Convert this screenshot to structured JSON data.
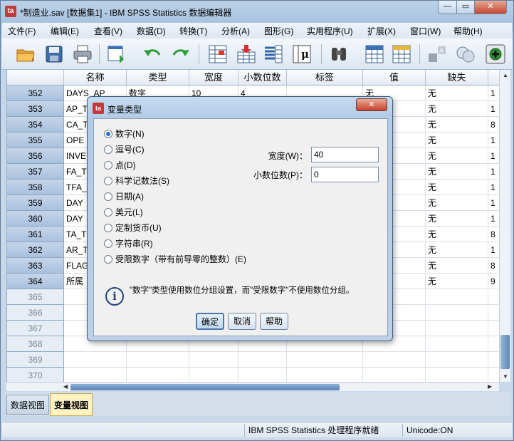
{
  "window": {
    "title": "*制造业.sav [数据集1] - IBM SPSS Statistics 数据编辑器",
    "app_icon": "spss-data-editor-icon"
  },
  "menu": [
    "文件(F)",
    "编辑(E)",
    "查看(V)",
    "数据(D)",
    "转换(T)",
    "分析(A)",
    "图形(G)",
    "实用程序(U)",
    "扩展(X)",
    "窗口(W)",
    "帮助(H)"
  ],
  "toolbar": [
    "open-folder-icon",
    "save-icon",
    "print-icon",
    "recall-dialog-icon",
    "undo-icon",
    "redo-icon",
    "goto-case-icon",
    "goto-variable-icon",
    "variables-icon",
    "value-labels-icon",
    "find-icon",
    "insert-cases-icon",
    "insert-variable-icon",
    "split-file-icon",
    "weight-cases-icon",
    "use-sets-icon",
    "add-icon"
  ],
  "grid": {
    "headers": [
      "名称",
      "类型",
      "宽度",
      "小数位数",
      "标签",
      "值",
      "缺失"
    ],
    "rows": [
      {
        "num": "352",
        "name": "DAYS_AP",
        "type": "数字",
        "width": "10",
        "dec": "4",
        "value": "无",
        "missing": "无",
        "extra": "1"
      },
      {
        "num": "353",
        "name": "AP_T",
        "type": "",
        "width": "",
        "dec": "",
        "value": "",
        "missing": "无",
        "extra": "1"
      },
      {
        "num": "354",
        "name": "CA_T",
        "type": "",
        "width": "",
        "dec": "",
        "value": "",
        "missing": "无",
        "extra": "8"
      },
      {
        "num": "355",
        "name": "OPE",
        "type": "",
        "width": "",
        "dec": "",
        "value": "",
        "missing": "无",
        "extra": "1"
      },
      {
        "num": "356",
        "name": "INVE",
        "type": "",
        "width": "",
        "dec": "",
        "value": "",
        "missing": "无",
        "extra": "1"
      },
      {
        "num": "357",
        "name": "FA_T",
        "type": "",
        "width": "",
        "dec": "",
        "value": "",
        "missing": "无",
        "extra": "1"
      },
      {
        "num": "358",
        "name": "TFA_",
        "type": "",
        "width": "",
        "dec": "",
        "value": "",
        "missing": "无",
        "extra": "1"
      },
      {
        "num": "359",
        "name": "DAY",
        "type": "",
        "width": "",
        "dec": "",
        "value": "",
        "missing": "无",
        "extra": "1"
      },
      {
        "num": "360",
        "name": "DAY",
        "type": "",
        "width": "",
        "dec": "",
        "value": "",
        "missing": "无",
        "extra": "1"
      },
      {
        "num": "361",
        "name": "TA_T",
        "type": "",
        "width": "",
        "dec": "",
        "value": "",
        "missing": "无",
        "extra": "8"
      },
      {
        "num": "362",
        "name": "AR_T",
        "type": "",
        "width": "",
        "dec": "",
        "value": "",
        "missing": "无",
        "extra": "1"
      },
      {
        "num": "363",
        "name": "FLAG",
        "type": "",
        "width": "",
        "dec": "",
        "value": "",
        "missing": "无",
        "extra": "8"
      },
      {
        "num": "364",
        "name": "所属",
        "type": "",
        "width": "",
        "dec": "",
        "value": "",
        "missing": "无",
        "extra": "9"
      }
    ],
    "empty_rows": [
      "365",
      "366",
      "367",
      "368",
      "369",
      "370"
    ]
  },
  "tabs": [
    "数据视图",
    "变量视图"
  ],
  "status": {
    "processor": "IBM SPSS Statistics 处理程序就绪",
    "encoding": "Unicode:ON"
  },
  "dialog": {
    "title": "变量类型",
    "types": [
      "数字(N)",
      "逗号(C)",
      "点(D)",
      "科学记数法(S)",
      "日期(A)",
      "美元(L)",
      "定制货币(U)",
      "字符串(R)",
      "受限数字（带有前导零的整数）(E)"
    ],
    "selected": 0,
    "width_label": "宽度(W)：",
    "width_value": "40",
    "decimals_label": "小数位数(P)：",
    "decimals_value": "0",
    "info": "\"数字\"类型使用数位分组设置，而\"受限数字\"不使用数位分组。",
    "ok": "确定",
    "cancel": "取消",
    "help": "帮助"
  }
}
